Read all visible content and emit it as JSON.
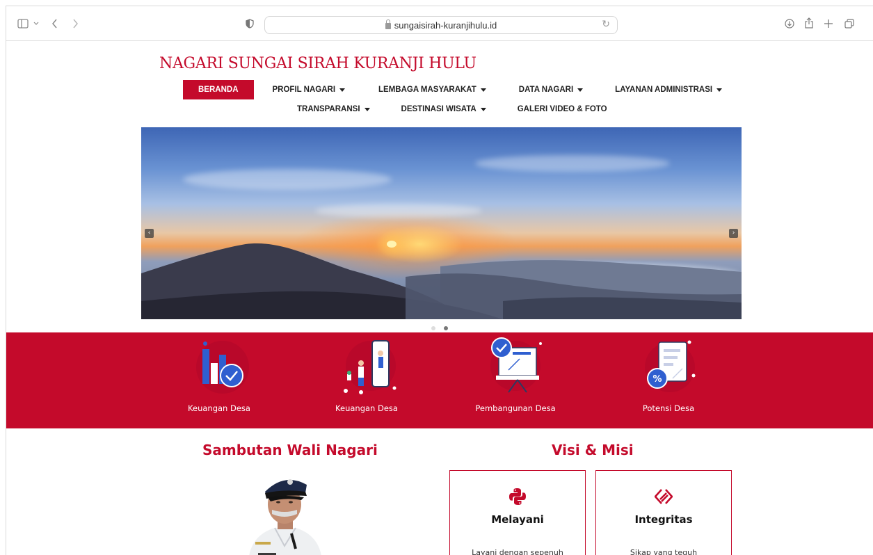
{
  "browser": {
    "url": "sungaisirah-kuranjihulu.id",
    "icons": [
      "sidebar-icon",
      "chevron-down-icon",
      "back-icon",
      "forward-icon",
      "shield-icon",
      "lock-icon",
      "reload-icon",
      "download-icon",
      "share-icon",
      "new-tab-icon",
      "tabs-overview-icon"
    ]
  },
  "site": {
    "title": "NAGARI SUNGAI SIRAH KURANJI HULU",
    "brand_color": "#c40a2b"
  },
  "nav": {
    "row1": [
      {
        "label": "BERANDA",
        "dropdown": false,
        "active": true
      },
      {
        "label": "PROFIL NAGARI",
        "dropdown": true
      },
      {
        "label": "LEMBAGA MASYARAKAT",
        "dropdown": true
      },
      {
        "label": "DATA NAGARI",
        "dropdown": true
      },
      {
        "label": "LAYANAN ADMINISTRASI",
        "dropdown": true
      }
    ],
    "row2": [
      {
        "label": "TRANSPARANSI",
        "dropdown": true
      },
      {
        "label": "DESTINASI WISATA",
        "dropdown": true
      },
      {
        "label": "GALERI VIDEO & FOTO",
        "dropdown": false
      }
    ]
  },
  "slider": {
    "prev_icon": "‹",
    "next_icon": "›",
    "slide_count": 2,
    "active_slide": 2
  },
  "features": [
    {
      "label": "Keuangan Desa",
      "icon": "bar-chart-check-icon"
    },
    {
      "label": "Keuangan Desa",
      "icon": "phone-person-icon"
    },
    {
      "label": "Pembangunan Desa",
      "icon": "presentation-check-icon"
    },
    {
      "label": "Potensi Desa",
      "icon": "document-percent-icon"
    }
  ],
  "sambutan": {
    "title": "Sambutan Wali Nagari"
  },
  "visi_misi": {
    "title": "Visi & Misi",
    "cards": [
      {
        "title": "Melayani",
        "text": "Layani dengan sepenuh",
        "icon": "python-logo-icon"
      },
      {
        "title": "Integritas",
        "text": "Sikap yang teguh",
        "icon": "diamond-arrows-icon"
      }
    ]
  }
}
